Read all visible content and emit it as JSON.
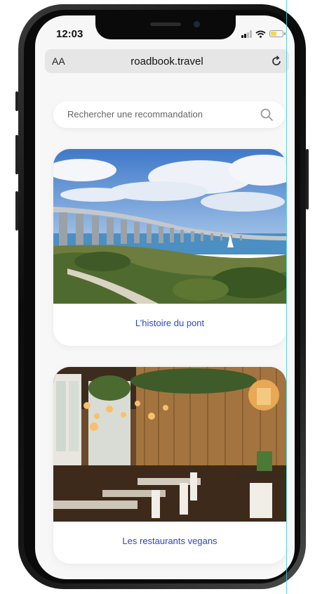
{
  "status": {
    "time": "12:03"
  },
  "browser": {
    "text_size": "AA",
    "url": "roadbook.travel",
    "reload_icon": "reload-icon"
  },
  "search": {
    "placeholder": "Rechercher une recommandation",
    "icon": "search-icon"
  },
  "cards": [
    {
      "label": "L’histoire du pont",
      "image": "bridge-photo"
    },
    {
      "label": "Les restaurants vegans",
      "image": "restaurant-photo"
    }
  ],
  "colors": {
    "accent": "#2f47c4",
    "background": "#f7f7f7",
    "battery": "#f5d84a"
  }
}
